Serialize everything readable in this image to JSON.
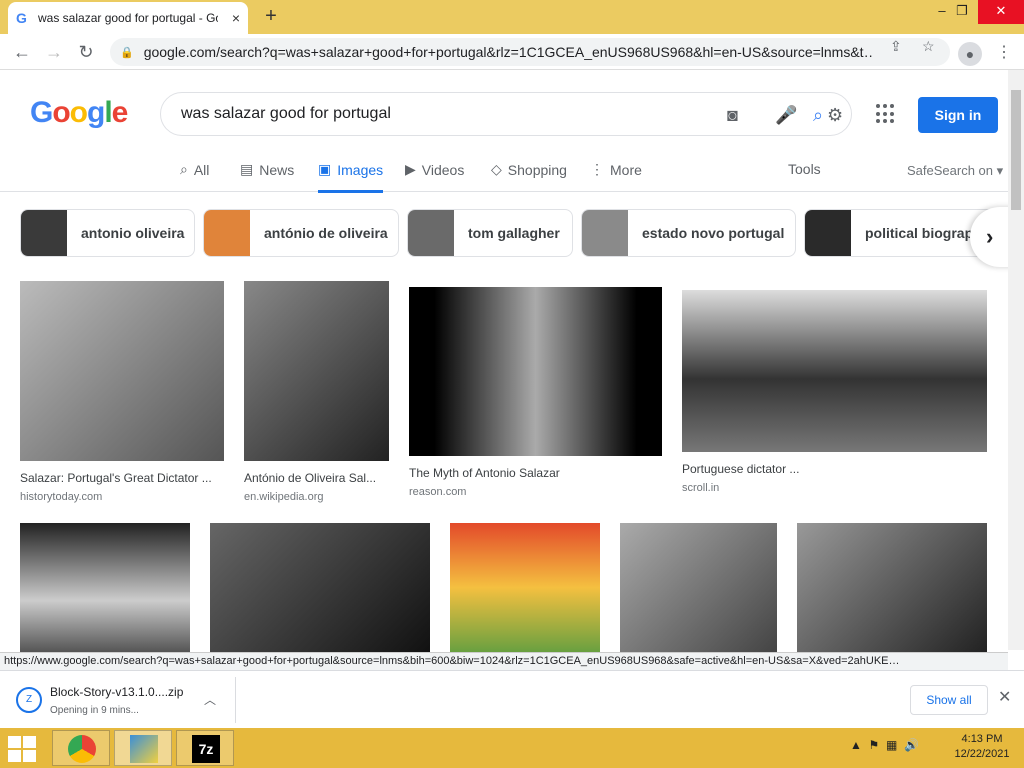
{
  "browser": {
    "tab_icon": "G",
    "tab_title": "was salazar good for portugal - Google Search",
    "tab_close": "×",
    "new_tab": "+",
    "window_controls": {
      "minimize": "–",
      "restore": "❐",
      "close": "✕"
    },
    "url": "google.com/search?q=was+salazar+good+for+portugal&rlz=1C1GCEA_enUS968US968&hl=en-US&source=lnms&t…",
    "status_url": "https://www.google.com/search?q=was+salazar+good+for+portugal&source=lnms&bih=600&biw=1024&rlz=1C1GCEA_enUS968US968&safe=active&hl=en-US&sa=X&ved=2ahUKE…"
  },
  "header": {
    "logo_letters": [
      "G",
      "o",
      "o",
      "g",
      "l",
      "e"
    ],
    "query": "was salazar good for portugal",
    "signin_label": "Sign in"
  },
  "tabs": [
    {
      "label": "All",
      "icon": "search-icon",
      "glyph": "⌕"
    },
    {
      "label": "News",
      "icon": "news-icon",
      "glyph": "▤"
    },
    {
      "label": "Images",
      "icon": "images-icon",
      "glyph": "▣",
      "active": true
    },
    {
      "label": "Videos",
      "icon": "video-icon",
      "glyph": "▶"
    },
    {
      "label": "Shopping",
      "icon": "tag-icon",
      "glyph": "◇"
    },
    {
      "label": "More",
      "icon": "more-vert-icon",
      "glyph": "⋮"
    }
  ],
  "tools_label": "Tools",
  "safesearch_label": "SafeSearch on ▾",
  "chips": [
    {
      "label": "antonio oliveira"
    },
    {
      "label": "antónio de oliveira"
    },
    {
      "label": "tom gallagher"
    },
    {
      "label": "estado novo portugal"
    },
    {
      "label": "political biograph"
    }
  ],
  "results_row1": [
    {
      "title": "Salazar: Portugal's Great Dictator ...",
      "source": "historytoday.com"
    },
    {
      "title": "António de Oliveira Sal...",
      "source": "en.wikipedia.org"
    },
    {
      "title": "The Myth of Antonio Salazar",
      "source": "reason.com"
    },
    {
      "title": "Portuguese dictator ...",
      "source": "scroll.in"
    }
  ],
  "results_row2_count_visible": 5,
  "download": {
    "filename": "Block-Story-v13.1.0....zip",
    "status": "Opening in 9 mins...",
    "show_all": "Show all"
  },
  "taskbar": {
    "time": "4:13 PM",
    "date": "12/22/2021",
    "apps": [
      "chrome-icon",
      "block-story-icon",
      "7zip-icon"
    ],
    "app_7z_label": "7z"
  }
}
